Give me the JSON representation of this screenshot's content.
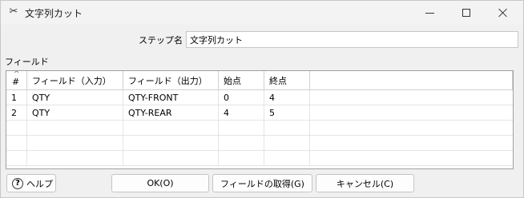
{
  "window": {
    "title": "文字列カット",
    "title_icon": "scissors-icon"
  },
  "form": {
    "step_label": "ステップ名",
    "step_value": "文字列カット",
    "fields_label": "フィールド"
  },
  "table": {
    "headers": [
      "#",
      "フィールド（入力）",
      "フィールド（出力）",
      "始点",
      "終点",
      ""
    ],
    "rows": [
      [
        "1",
        "QTY",
        "QTY-FRONT",
        "0",
        "4",
        ""
      ],
      [
        "2",
        "QTY",
        "QTY-REAR",
        "4",
        "5",
        ""
      ],
      [
        "",
        "",
        "",
        "",
        "",
        ""
      ],
      [
        "",
        "",
        "",
        "",
        "",
        ""
      ],
      [
        "",
        "",
        "",
        "",
        "",
        ""
      ]
    ]
  },
  "buttons": {
    "help": "ヘルプ",
    "ok": "OK(O)",
    "get_fields": "フィールドの取得(G)",
    "cancel": "キャンセル(C)"
  }
}
